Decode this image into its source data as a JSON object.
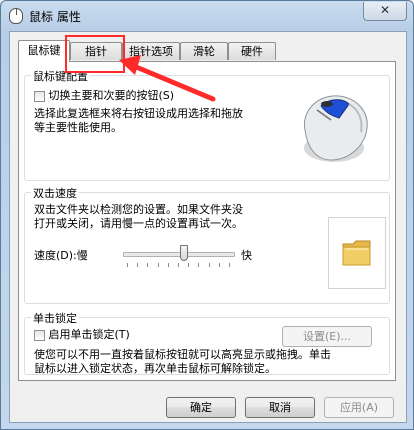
{
  "window": {
    "title": "鼠标 属性",
    "close_glyph": "✕"
  },
  "tabs": [
    {
      "label": "鼠标键",
      "active": true
    },
    {
      "label": "指针",
      "active": false
    },
    {
      "label": "指针选项",
      "active": false
    },
    {
      "label": "滑轮",
      "active": false
    },
    {
      "label": "硬件",
      "active": false
    }
  ],
  "button_config": {
    "title": "鼠标键配置",
    "checkbox_label": "切换主要和次要的按钮(S)",
    "checked": false,
    "description_line1": "选择此复选框来将右按钮设成用选择和拖放",
    "description_line2": "等主要性能使用。"
  },
  "double_click": {
    "title": "双击速度",
    "description_line1": "双击文件夹以检测您的设置。如果文件夹没",
    "description_line2": "打开或关闭，请用慢一点的设置再试一次。",
    "speed_label": "速度(D):慢",
    "fast_label": "快",
    "speed_value": 0.55
  },
  "click_lock": {
    "title": "单击锁定",
    "checkbox_label": "启用单击锁定(T)",
    "checked": false,
    "settings_button": "设置(E)...",
    "description_line1": "使您可以不用一直按着鼠标按钮就可以高亮显示或拖拽。单击",
    "description_line2": "鼠标以进入锁定状态，再次单击鼠标可解除锁定。"
  },
  "footer": {
    "ok": "确定",
    "cancel": "取消",
    "apply": "应用(A)"
  },
  "colors": {
    "annotation": "#ff2a2a",
    "folder": "#f2cf66"
  }
}
